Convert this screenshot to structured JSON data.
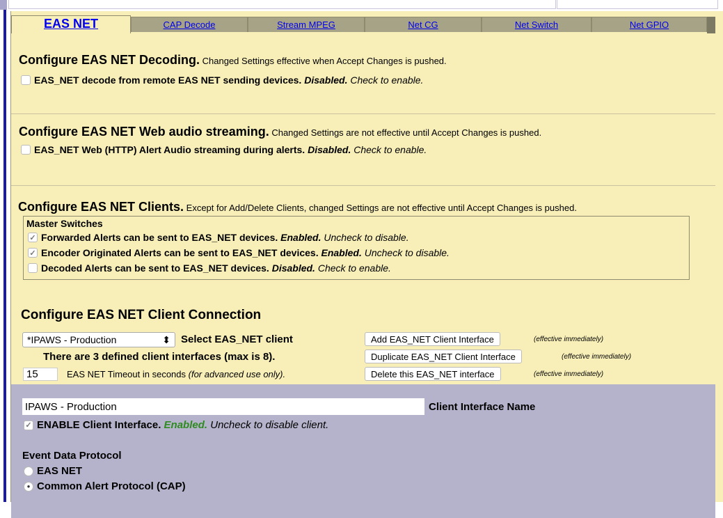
{
  "tabs": [
    {
      "label": "EAS NET",
      "active": true
    },
    {
      "label": "CAP Decode"
    },
    {
      "label": "Stream MPEG"
    },
    {
      "label": "Net CG"
    },
    {
      "label": "Net Switch"
    },
    {
      "label": "Net GPIO"
    }
  ],
  "decoding": {
    "heading": "Configure EAS NET Decoding.",
    "note": "Changed Settings effective when Accept Changes is pushed.",
    "option_label": "EAS_NET decode from remote EAS NET sending devices.",
    "option_status": "Disabled.",
    "option_hint": "Check to enable."
  },
  "web_audio": {
    "heading": "Configure EAS NET Web audio streaming.",
    "note": "Changed Settings are not effective until Accept Changes is pushed.",
    "option_label": "EAS_NET Web (HTTP) Alert Audio streaming during alerts.",
    "option_status": "Disabled.",
    "option_hint": "Check to enable."
  },
  "clients": {
    "heading": "Configure EAS NET Clients.",
    "note": "Except for Add/Delete Clients, changed Settings are not effective until Accept Changes is pushed.",
    "master_title": "Master Switches",
    "switches": [
      {
        "label": "Forwarded Alerts can be sent to EAS_NET devices.",
        "status": "Enabled.",
        "hint": "Uncheck to disable."
      },
      {
        "label": "Encoder Originated Alerts can be sent to EAS_NET devices.",
        "status": "Enabled.",
        "hint": "Uncheck to disable."
      },
      {
        "label": "Decoded Alerts can be sent to EAS_NET devices.",
        "status": "Disabled.",
        "hint": "Check to enable."
      }
    ]
  },
  "connection": {
    "heading": "Configure EAS NET Client Connection",
    "select_value": "*IPAWS - Production",
    "select_label": "Select EAS_NET client",
    "count_text": "There are 3 defined client interfaces (max is 8).",
    "timeout_value": "15",
    "timeout_label": "EAS NET Timeout in seconds",
    "timeout_note": "(for advanced use only).",
    "buttons": [
      {
        "label": "Add EAS_NET Client Interface",
        "note": "(effective immediately)"
      },
      {
        "label": "Duplicate EAS_NET Client Interface",
        "note": "(effective immediately)"
      },
      {
        "label": "Delete this EAS_NET interface",
        "note": "(effective immediately)"
      }
    ]
  },
  "client_interface": {
    "name_value": "IPAWS - Production",
    "name_label": "Client Interface Name",
    "enable_label": "ENABLE Client Interface.",
    "enable_status": "Enabled.",
    "enable_hint": "Uncheck to disable client.",
    "status_color": "#2e8b1f",
    "protocol_title": "Event Data Protocol",
    "protocols": [
      {
        "label": "EAS NET",
        "selected": false
      },
      {
        "label": "Common Alert Protocol (CAP)",
        "selected": true
      }
    ]
  }
}
